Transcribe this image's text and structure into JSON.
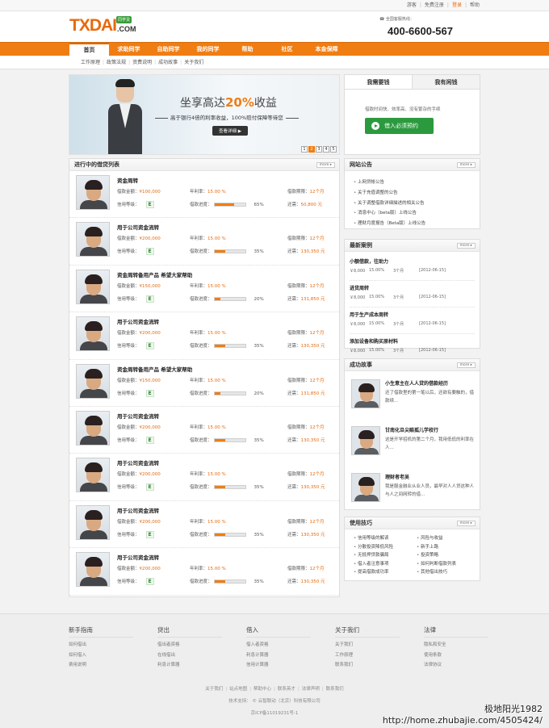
{
  "topbar": {
    "links": [
      "游客",
      "免费注册",
      "登录",
      "帮助"
    ]
  },
  "logo": {
    "main": "TXDAI",
    "suffix": ".COM",
    "badge": "同学贷"
  },
  "hotline": {
    "label": "全国客服热线：",
    "number": "400-6600-567"
  },
  "nav": {
    "items": [
      "首页",
      "求助同学",
      "自助同学",
      "我的同学",
      "帮助",
      "社区",
      "本金保障"
    ]
  },
  "subnav": {
    "items": [
      "工作原理",
      "政策法规",
      "资费说明",
      "成功故事",
      "关于我们"
    ]
  },
  "banner": {
    "headline_pre": "坐享高达",
    "headline_hl": "20%",
    "headline_post": "收益",
    "sub": "高于银行4倍的利率收益，100%赔付保障等待您",
    "button": "查看详细 ▶",
    "pages": [
      "1",
      "2",
      "3",
      "4",
      "5"
    ]
  },
  "tabs": {
    "tab1": "我需要钱",
    "tab2": "我有闲钱",
    "desc": "借款时间快、效率高、没有繁杂的手续",
    "apply": "借入必须预约"
  },
  "loans_panel": {
    "title": "进行中的借贷列表",
    "more": "more ▸"
  },
  "loans": [
    {
      "title": "资金周转",
      "amount": "¥100,000",
      "rate": "15.00 %",
      "term": "12个月",
      "grade": "E",
      "progress": 65,
      "progress_text": "65%",
      "remain": "50,800 元"
    },
    {
      "title": "用于公司资金流转",
      "amount": "¥200,000",
      "rate": "15.00 %",
      "term": "12个月",
      "grade": "E",
      "progress": 35,
      "progress_text": "35%",
      "remain": "130,350 元"
    },
    {
      "title": "资金周转备用产品 希望大家帮助",
      "amount": "¥150,000",
      "rate": "15.00 %",
      "term": "12个月",
      "grade": "E",
      "progress": 20,
      "progress_text": "20%",
      "remain": "131,850 元"
    },
    {
      "title": "用于公司资金流转",
      "amount": "¥200,000",
      "rate": "15.00 %",
      "term": "12个月",
      "grade": "E",
      "progress": 35,
      "progress_text": "35%",
      "remain": "130,350 元"
    },
    {
      "title": "资金周转备用产品 希望大家帮助",
      "amount": "¥150,000",
      "rate": "15.00 %",
      "term": "12个月",
      "grade": "E",
      "progress": 20,
      "progress_text": "20%",
      "remain": "131,850 元"
    },
    {
      "title": "用于公司资金流转",
      "amount": "¥200,000",
      "rate": "15.00 %",
      "term": "12个月",
      "grade": "E",
      "progress": 35,
      "progress_text": "35%",
      "remain": "130,350 元"
    },
    {
      "title": "用于公司资金流转",
      "amount": "¥200,000",
      "rate": "15.00 %",
      "term": "12个月",
      "grade": "E",
      "progress": 35,
      "progress_text": "35%",
      "remain": "130,350 元"
    },
    {
      "title": "用于公司资金流转",
      "amount": "¥200,000",
      "rate": "15.00 %",
      "term": "12个月",
      "grade": "E",
      "progress": 35,
      "progress_text": "35%",
      "remain": "130,350 元"
    },
    {
      "title": "用于公司资金流转",
      "amount": "¥200,000",
      "rate": "15.00 %",
      "term": "12个月",
      "grade": "E",
      "progress": 35,
      "progress_text": "35%",
      "remain": "130,350 元"
    }
  ],
  "labels": {
    "amount": "借款金额：",
    "rate": "年利率：",
    "term": "借款期限：",
    "grade": "信用等级：",
    "progress": "借款进度：",
    "remain": "还需："
  },
  "notice": {
    "title": "网站公告",
    "more": "more ▸",
    "items": [
      "上网贷帐公告",
      "关于充值调整的公告",
      "关于调整借款详细描述的相关公告",
      "消息中心（beta版）上线公告",
      "理财月度报告（Beta版）上线公告"
    ]
  },
  "cases": {
    "title": "最新案例",
    "more": "more ▸",
    "items": [
      {
        "title": "小额借款，往助力",
        "amount": "￥8,000",
        "rate": "15.00%",
        "term": "3个月",
        "date": "[2012-06-15]"
      },
      {
        "title": "进货周转",
        "amount": "￥8,000",
        "rate": "15.00%",
        "term": "3个月",
        "date": "[2012-06-15]"
      },
      {
        "title": "用于生产成本周转",
        "amount": "￥8,000",
        "rate": "15.00%",
        "term": "3个月",
        "date": "[2012-06-15]"
      },
      {
        "title": "添加设备和购买原材料",
        "amount": "￥8,000",
        "rate": "15.00%",
        "term": "3个月",
        "date": "[2012-06-15]"
      }
    ]
  },
  "stories": {
    "title": "成功故事",
    "more": "more ▸",
    "items": [
      {
        "title": "小生意主在人人贷的借款经历",
        "text": "还了借款里的第一笔以后，还欲有要触的，借款续..."
      },
      {
        "title": "甘南化旦尖赔孤儿学校行",
        "text": "这是开学招机的第二个月，我用低低的利率在人..."
      },
      {
        "title": "理财者老吴",
        "text": "我是服金融业从业人员，最早对人人贷这种人与人之间网转的借..."
      }
    ]
  },
  "tips": {
    "title": "使用技巧",
    "more": "more ▸",
    "items": [
      "信用等级的解读",
      "风险与收益",
      "分散投资降低风险",
      "新手上路",
      "无抵押贷款骗局",
      "投资策略",
      "借入者注意事项",
      "如何判断借款列表",
      "提高借款成功率",
      "其他借出技巧"
    ]
  },
  "footer": {
    "cols": [
      {
        "title": "新手指南",
        "links": [
          "如何借出",
          "如何借入",
          "费用说明"
        ]
      },
      {
        "title": "贷出",
        "links": [
          "借出者资格",
          "在线借出",
          "利息计算器"
        ]
      },
      {
        "title": "借入",
        "links": [
          "借入者资格",
          "利息计算器",
          "信用计算器"
        ]
      },
      {
        "title": "关于我们",
        "links": [
          "关于我们",
          "工作原理",
          "联系我们"
        ]
      },
      {
        "title": "法律",
        "links": [
          "隐私和安全",
          "使用条款",
          "法律协议"
        ]
      }
    ],
    "bottom_links": [
      "关于我们",
      "站点地图",
      "帮助中心",
      "联系英才",
      "法律声明",
      "联系我们"
    ],
    "tech": "技术支持：",
    "company": "云智联动（北京）科技有限公司",
    "icp": "京ICP备11019231号-1"
  },
  "watermark": {
    "line1": "极地阳光1982",
    "line2": "http://home.zhubajie.com/4505424/"
  }
}
